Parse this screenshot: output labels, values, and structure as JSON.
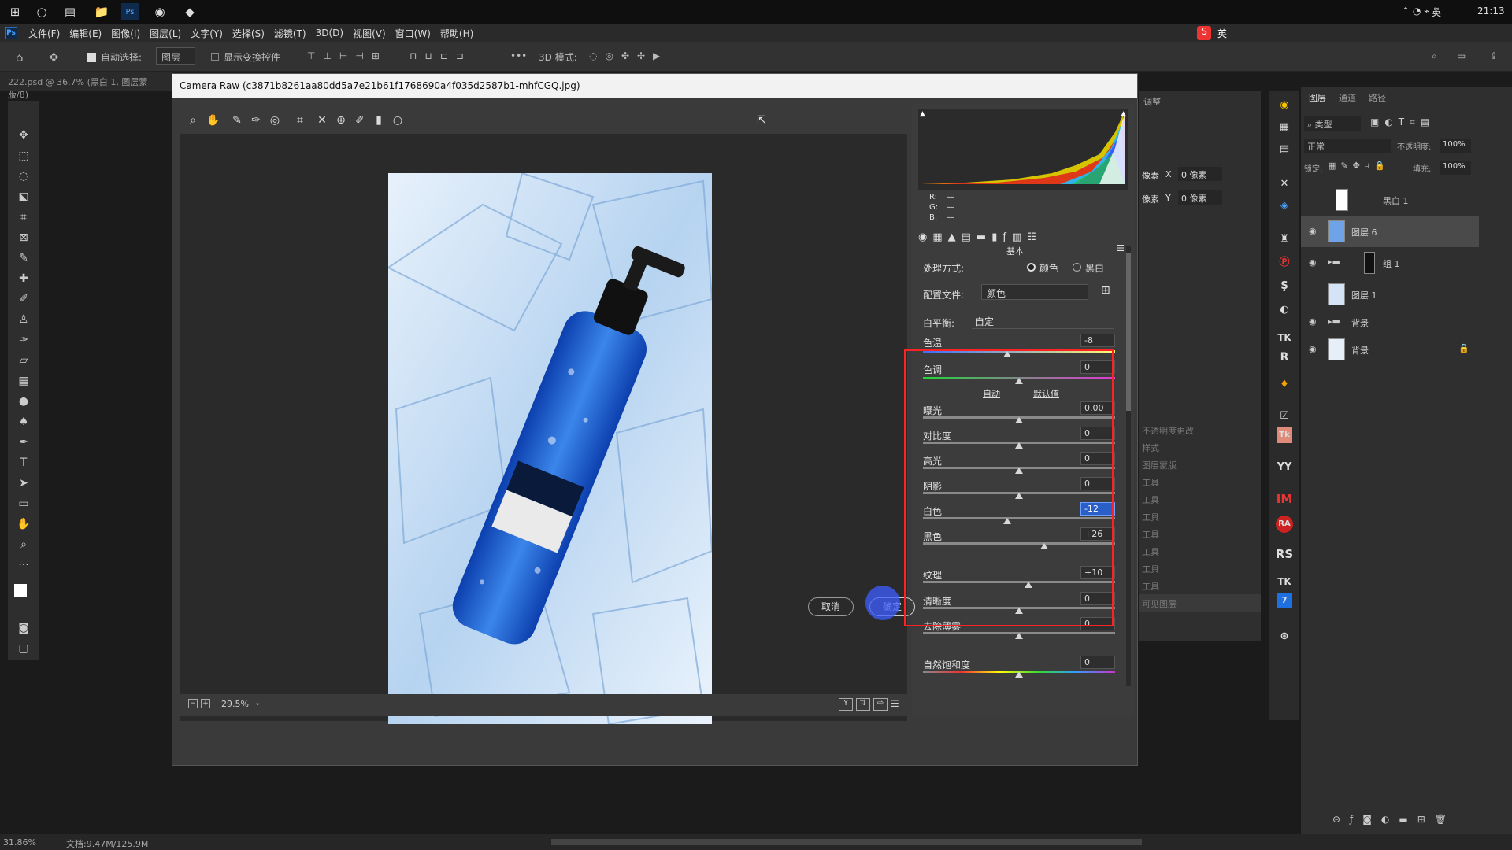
{
  "taskbar": {
    "time": "21:13",
    "ime_label": "英",
    "tray_lang": "英"
  },
  "menubar": {
    "app_icon": "Ps",
    "items": [
      "文件(F)",
      "编辑(E)",
      "图像(I)",
      "图层(L)",
      "文字(Y)",
      "选择(S)",
      "滤镜(T)",
      "3D(D)",
      "视图(V)",
      "窗口(W)",
      "帮助(H)"
    ]
  },
  "optbar": {
    "auto_select_label": "自动选择:",
    "auto_select_value": "图层",
    "show_transform_label": "显示变换控件",
    "mode3d": "3D 模式:"
  },
  "doc_tab": {
    "label": "222.psd @ 36.7% (黑白 1, 图层蒙版/8)"
  },
  "dialog": {
    "title": "Camera Raw (c3871b8261aa80dd5a7e21b61f1768690a4f035d2587b1-mhfCGQ.jpg)",
    "zoom": "29.5%",
    "histogram": {
      "r_label": "R:",
      "g_label": "G:",
      "b_label": "B:",
      "r_value": "—",
      "g_value": "—",
      "b_value": "—"
    },
    "section_title": "基本",
    "treatment_label": "处理方式:",
    "treatment_color": "颜色",
    "treatment_bw": "黑白",
    "profile_label": "配置文件:",
    "profile_value": "颜色",
    "wb_label": "白平衡:",
    "wb_value": "自定",
    "auto_label": "自动",
    "default_label": "默认值",
    "sliders": [
      {
        "label": "色温",
        "value": "-8",
        "pos": 0.44
      },
      {
        "label": "色调",
        "value": "0",
        "pos": 0.5
      },
      {
        "label": "曝光",
        "value": "0.00",
        "pos": 0.5
      },
      {
        "label": "对比度",
        "value": "0",
        "pos": 0.5
      },
      {
        "label": "高光",
        "value": "0",
        "pos": 0.5
      },
      {
        "label": "阴影",
        "value": "0",
        "pos": 0.5
      },
      {
        "label": "白色",
        "value": "-12",
        "pos": 0.44
      },
      {
        "label": "黑色",
        "value": "+26",
        "pos": 0.63
      },
      {
        "label": "纹理",
        "value": "+10",
        "pos": 0.55
      },
      {
        "label": "清晰度",
        "value": "0",
        "pos": 0.5
      },
      {
        "label": "去除薄雾",
        "value": "0",
        "pos": 0.5
      },
      {
        "label": "自然饱和度",
        "value": "0",
        "pos": 0.5
      }
    ],
    "cancel_label": "取消",
    "ok_label": "确定"
  },
  "adjust_panel": {
    "title": "调整",
    "x_label": "像素",
    "x_value": "0 像素",
    "y_label": "像素",
    "y_value": "0 像素",
    "items": [
      "不透明度更改",
      "样式",
      "图层蒙版",
      "工具",
      "工具",
      "工具",
      "工具",
      "工具",
      "工具",
      "工具",
      "可见图层"
    ]
  },
  "layers_panel": {
    "tabs": [
      "图层",
      "通道",
      "路径"
    ],
    "kind_label": "类型",
    "blend_mode": "正常",
    "opacity_label": "不透明度:",
    "opacity_value": "100%",
    "lock_label": "锁定:",
    "fill_label": "填充:",
    "fill_value": "100%",
    "layers": [
      {
        "name": "黑白 1",
        "visible": false
      },
      {
        "name": "图层 6",
        "visible": true
      },
      {
        "name": "组 1",
        "visible": true
      },
      {
        "name": "图层 1",
        "visible": false
      },
      {
        "name": "背景",
        "visible": true
      },
      {
        "name": "背景",
        "visible": true
      }
    ]
  },
  "iconstrip": [
    "TK",
    "R",
    "IM",
    "RA",
    "RS",
    "YY",
    "TK"
  ],
  "statusbar": {
    "zoom": "31.86%",
    "doc": "文档:9.47M/125.9M"
  },
  "colors": {
    "highlight_box": "#ff2222",
    "photo_blue": "#2c6fd6"
  }
}
